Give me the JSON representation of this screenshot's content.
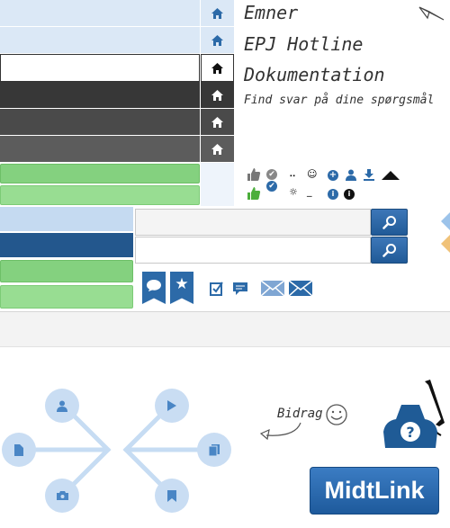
{
  "nav": {
    "items": [
      {
        "label": "Emner"
      },
      {
        "label": "EPJ Hotline"
      },
      {
        "label": "Dokumentation"
      }
    ],
    "tagline": "Find svar på dine spørgsmål"
  },
  "contribution": {
    "label": "Bidrag"
  },
  "brand": {
    "logo_text": "MidtLink"
  },
  "colors": {
    "light_blue": "#dbe8f6",
    "dark_gray": "#3a3a3a",
    "green": "#84d17f",
    "navy": "#23578d",
    "button_blue": "#2c6aa8"
  },
  "icons": [
    "home-icon",
    "search-icon",
    "speech-bubble-icon",
    "star-icon",
    "envelope-icon",
    "phone-icon",
    "smiley-icon",
    "thumbs-up-icon"
  ]
}
